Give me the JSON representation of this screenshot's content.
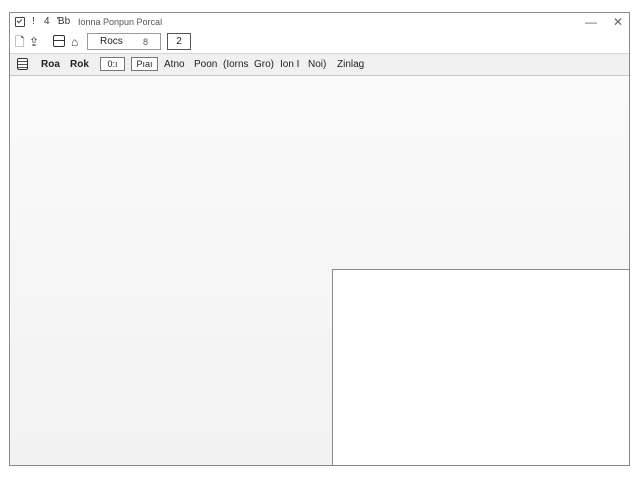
{
  "titlebar": {
    "quick_access": [
      "!",
      "4",
      "Ɓb"
    ],
    "title": "Ionna Ponpun Porcal",
    "minimize_glyph": "—",
    "close_glyph": "✕"
  },
  "toolbar": {
    "name_field_value": "Rocs",
    "lock_glyph": "8",
    "count_value": "2"
  },
  "menubar": {
    "items": [
      "Roa",
      "Rok"
    ],
    "box_items": [
      "0:ı",
      "Pıaı"
    ],
    "plain_items": [
      "Atno",
      "Poon",
      "(Iorns",
      "Gro)",
      "Ion I",
      "Noi)",
      "Zinlag"
    ]
  }
}
